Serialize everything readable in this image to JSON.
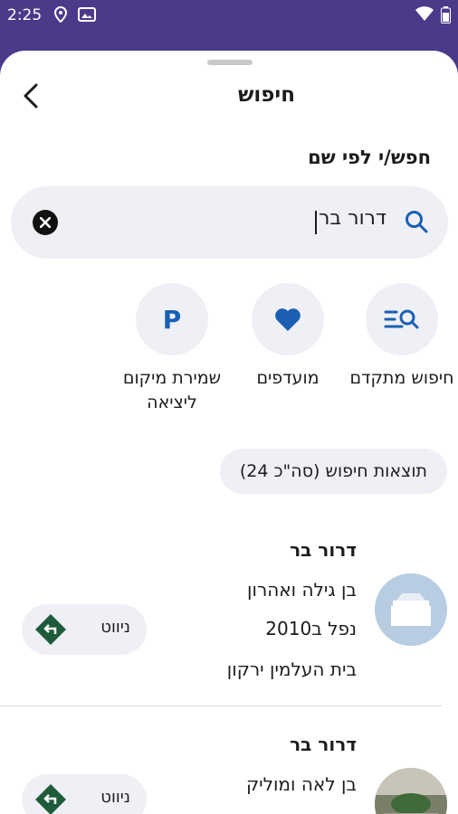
{
  "status_bar": {
    "time": "2:25"
  },
  "header": {
    "title": "חיפוש"
  },
  "search": {
    "section_label": "חפש/י לפי שם",
    "query": "דרור בר"
  },
  "quick_actions": [
    {
      "label": "חיפוש מתקדם",
      "icon": "advanced-search-icon"
    },
    {
      "label": "מועדפים",
      "icon": "heart-icon"
    },
    {
      "label": "שמירת מיקום ליציאה",
      "icon": "parking-icon",
      "glyph": "P"
    }
  ],
  "results": {
    "chip": "תוצאות חיפוש (סה\"כ 24)",
    "items": [
      {
        "name": "דרור בר",
        "parents": "בן גילה ואהרון",
        "fell": "נפל ב2010",
        "cemetery": "בית העלמין ירקון",
        "navigate": "ניווט"
      },
      {
        "name": "דרור בר",
        "parents": "בן לאה ומוליק",
        "navigate": "ניווט"
      }
    ]
  },
  "colors": {
    "status_bar": "#4b3a8a",
    "accent": "#1a5fb4",
    "nav_green": "#1f5b3a",
    "chip_bg": "#eef0f5"
  }
}
